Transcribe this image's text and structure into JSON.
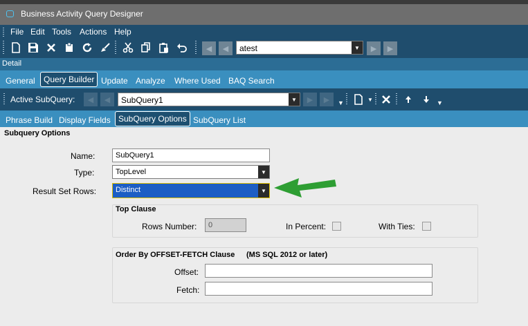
{
  "window": {
    "title": "Business Activity Query Designer"
  },
  "menu": {
    "items": [
      "File",
      "Edit",
      "Tools",
      "Actions",
      "Help"
    ]
  },
  "toolbar": {
    "record_value": "atest"
  },
  "detail_bar": {
    "label": "Detail"
  },
  "main_tabs": [
    "General",
    "Query Builder",
    "Update",
    "Analyze",
    "Where Used",
    "BAQ Search"
  ],
  "subquery_bar": {
    "label": "Active SubQuery:",
    "value": "SubQuery1"
  },
  "sub_tabs": [
    "Phrase Build",
    "Display Fields",
    "SubQuery Options",
    "SubQuery List"
  ],
  "section": {
    "title": "Subquery Options"
  },
  "form": {
    "name_label": "Name:",
    "name_value": "SubQuery1",
    "type_label": "Type:",
    "type_value": "TopLevel",
    "result_label": "Result Set Rows:",
    "result_value": "Distinct"
  },
  "top_clause": {
    "title": "Top Clause",
    "rows_label": "Rows Number:",
    "rows_value": "0",
    "percent_label": "In Percent:",
    "ties_label": "With Ties:"
  },
  "order_by": {
    "title": "Order By OFFSET-FETCH Clause",
    "note": "(MS SQL 2012 or later)",
    "offset_label": "Offset:",
    "fetch_label": "Fetch:"
  },
  "colors": {
    "menu_bg": "#1f4d6d",
    "tab_bg": "#3a8fbf",
    "highlight": "#1c5ec4",
    "arrow": "#2e9e33"
  }
}
